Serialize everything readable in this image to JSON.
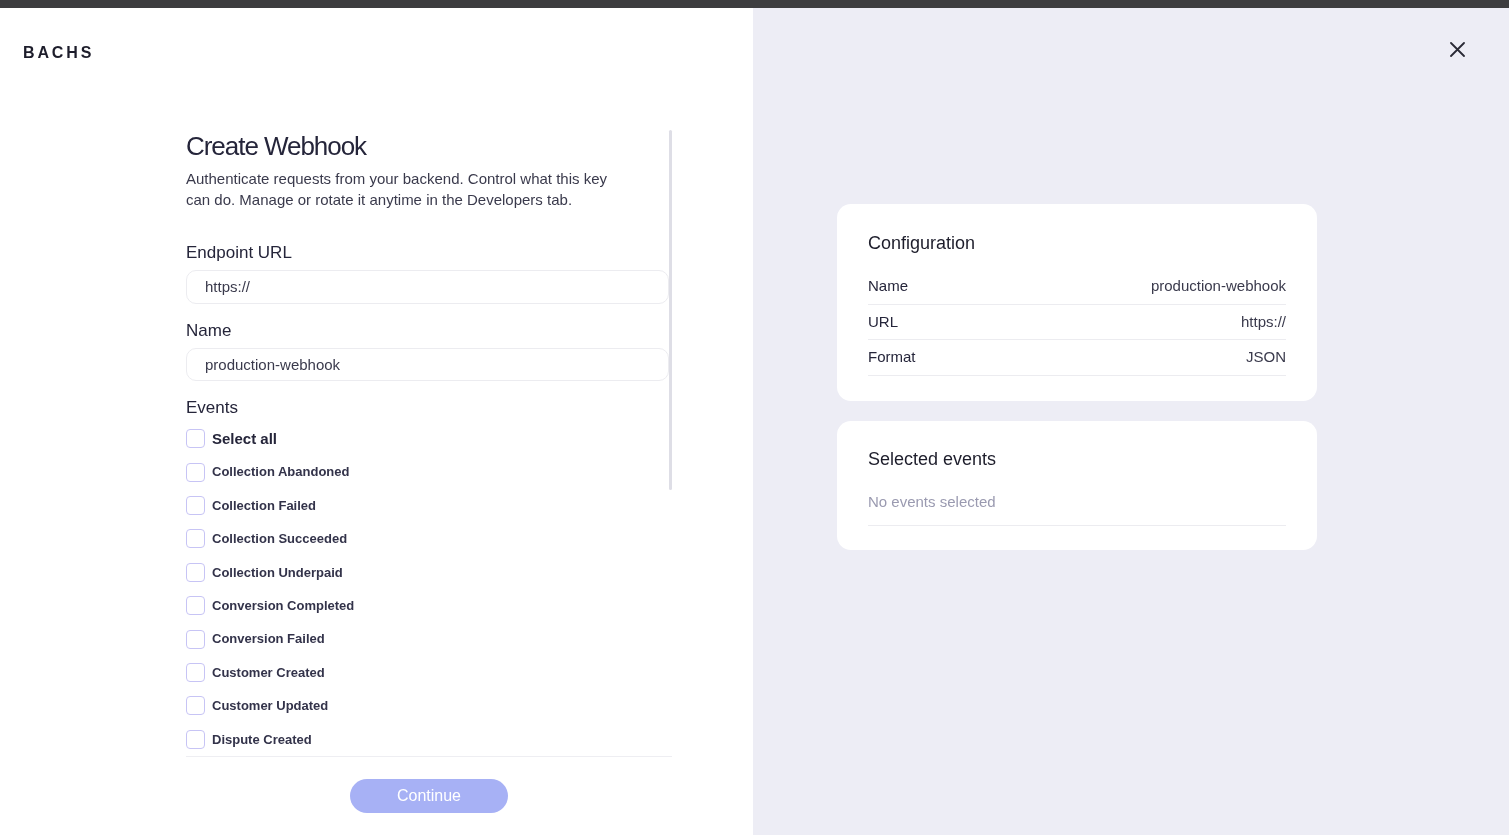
{
  "logo": "BACHS",
  "form": {
    "title": "Create Webhook",
    "description": "Authenticate requests from your backend. Control what this key can do. Manage or rotate it anytime in the Developers tab.",
    "fields": [
      {
        "label": "Endpoint URL",
        "value": "https://"
      },
      {
        "label": "Name",
        "value": "production-webhook"
      }
    ],
    "events_label": "Events",
    "select_all": {
      "label": "Select all",
      "checked": false
    },
    "events": [
      {
        "label": "Collection Abandoned",
        "checked": false
      },
      {
        "label": "Collection Failed",
        "checked": false
      },
      {
        "label": "Collection Succeeded",
        "checked": false
      },
      {
        "label": "Collection Underpaid",
        "checked": false
      },
      {
        "label": "Conversion Completed",
        "checked": false
      },
      {
        "label": "Conversion Failed",
        "checked": false
      },
      {
        "label": "Customer Created",
        "checked": false
      },
      {
        "label": "Customer Updated",
        "checked": false
      },
      {
        "label": "Dispute Created",
        "checked": false
      }
    ],
    "continue_button": {
      "label": "Continue",
      "disabled": true
    }
  },
  "configuration": {
    "title": "Configuration",
    "rows": [
      {
        "label": "Name",
        "value": "production-webhook"
      },
      {
        "label": "URL",
        "value": "https://"
      },
      {
        "label": "Format",
        "value": "JSON"
      }
    ]
  },
  "selected_events": {
    "title": "Selected events",
    "empty_text": "No events selected"
  }
}
